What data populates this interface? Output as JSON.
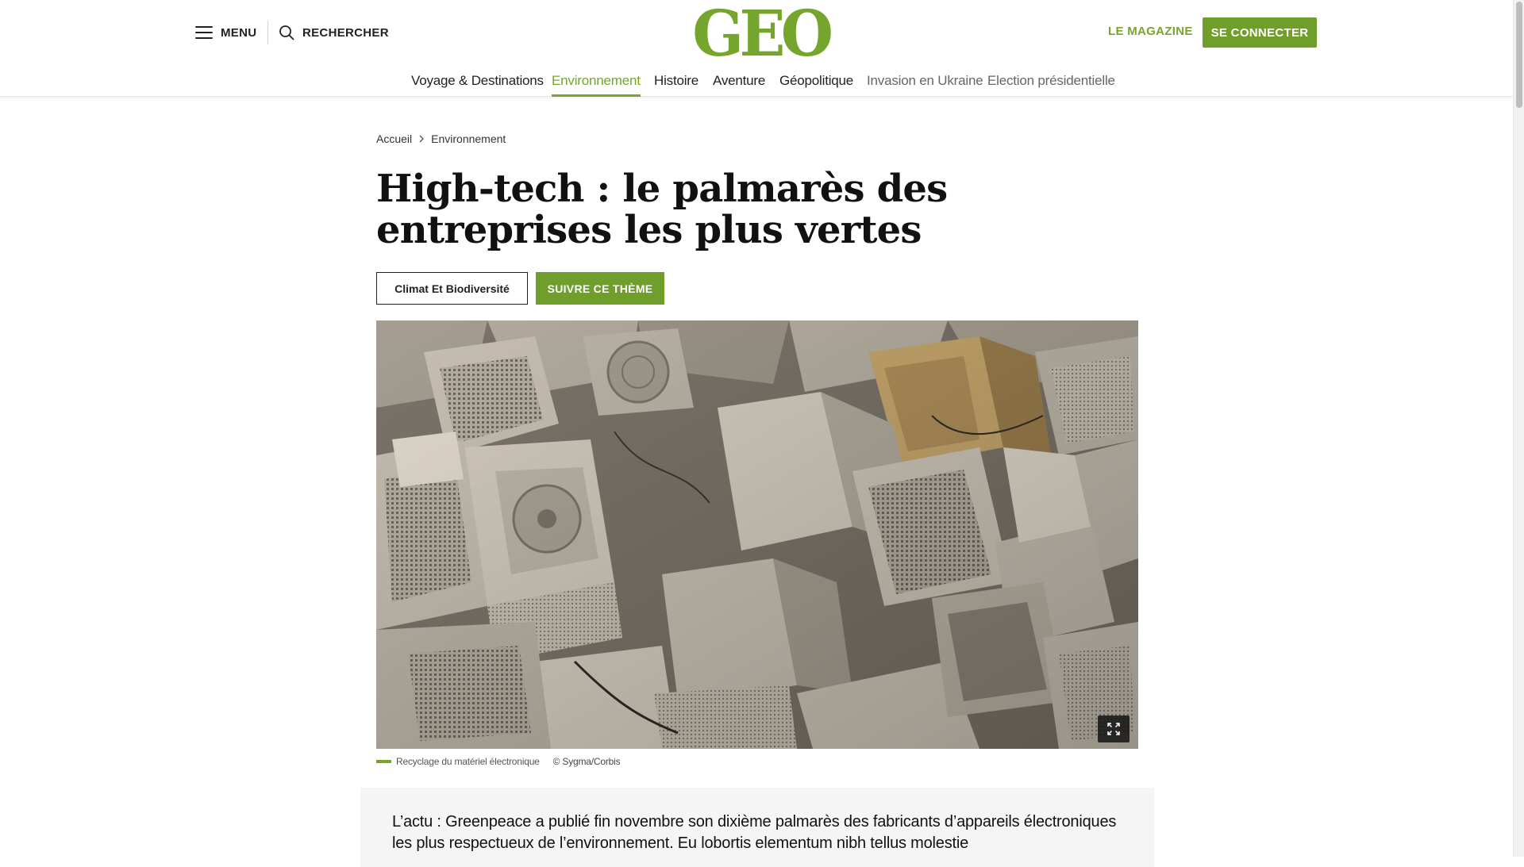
{
  "header": {
    "menu_label": "MENU",
    "search_label": "RECHERCHER",
    "logo_text": "GEO",
    "magazine_label": "LE MAGAZINE",
    "connect_label": "SE CONNECTER"
  },
  "nav": {
    "items": [
      {
        "label": "Voyage & Destinations"
      },
      {
        "label": "Environnement"
      },
      {
        "label": "Histoire"
      },
      {
        "label": "Aventure"
      },
      {
        "label": "Géopolitique"
      },
      {
        "label": "Invasion en Ukraine"
      },
      {
        "label": "Election présidentielle"
      }
    ],
    "active": "Environnement"
  },
  "breadcrumb": {
    "home": "Accueil",
    "current": "Environnement"
  },
  "article": {
    "title": "High-tech : le palmarès des entreprises les plus vertes",
    "tag_label": "Climat Et Biodiversité",
    "follow_label": "SUIVRE CE THÈME",
    "image_caption": "Recyclage du matériel électronique",
    "image_credit": "© Sygma/Corbis",
    "lead": "L’actu : Greenpeace a publié fin novembre son dixième palmarès des fabricants d’appareils électroniques les plus respectueux de l’environnement. Eu lobortis elementum nibh tellus molestie"
  },
  "colors": {
    "brand_green": "#75a52c",
    "button_green": "#6f9e2a"
  },
  "icons": {
    "menu": "hamburger-icon",
    "search": "search-icon",
    "breadcrumb_separator": "chevron-right-icon",
    "expand": "expand-icon"
  }
}
